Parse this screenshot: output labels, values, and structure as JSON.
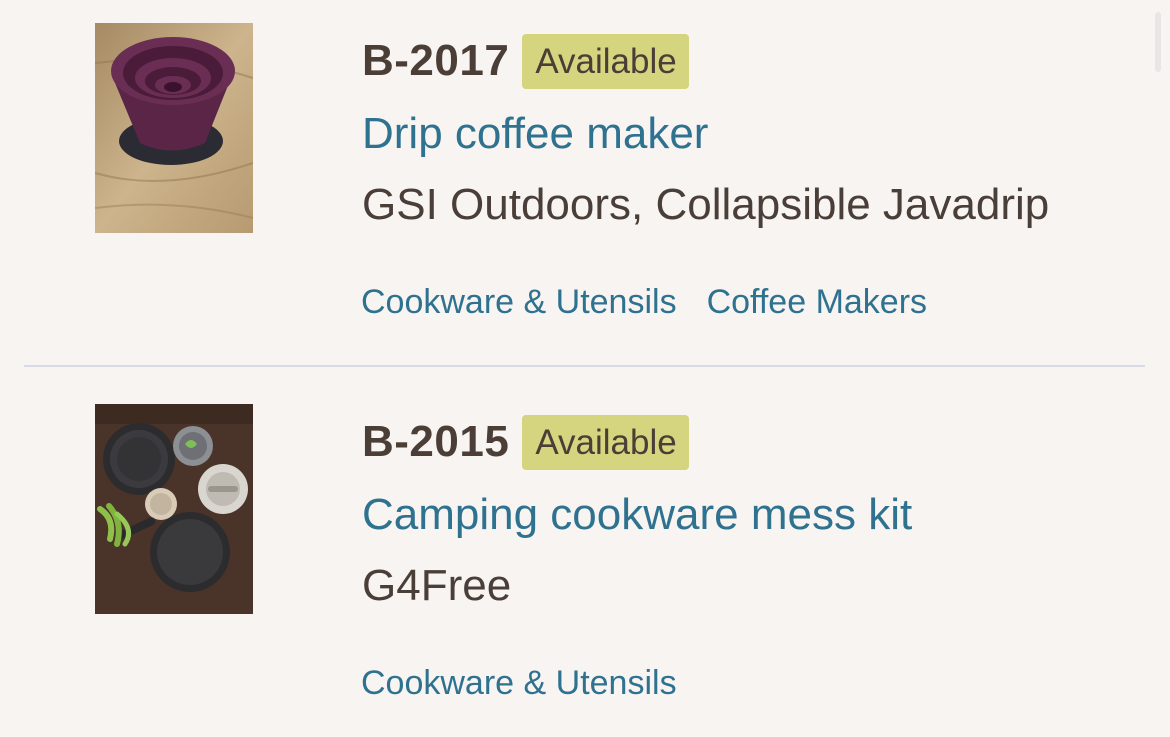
{
  "items": [
    {
      "code": "B-2017",
      "status": "Available",
      "title": "Drip coffee maker",
      "brand": "GSI Outdoors, Collapsible Javadrip",
      "tags": [
        "Cookware & Utensils",
        "Coffee Makers"
      ],
      "image": "collapsible-drip-coffee-maker-photo"
    },
    {
      "code": "B-2015",
      "status": "Available",
      "title": "Camping cookware mess kit",
      "brand": "G4Free",
      "tags": [
        "Cookware & Utensils"
      ],
      "image": "camping-mess-kit-photo"
    }
  ],
  "colors": {
    "background": "#f8f4f2",
    "link": "#2e7290",
    "badge": "#d4d57e",
    "text": "#4a3e38"
  }
}
